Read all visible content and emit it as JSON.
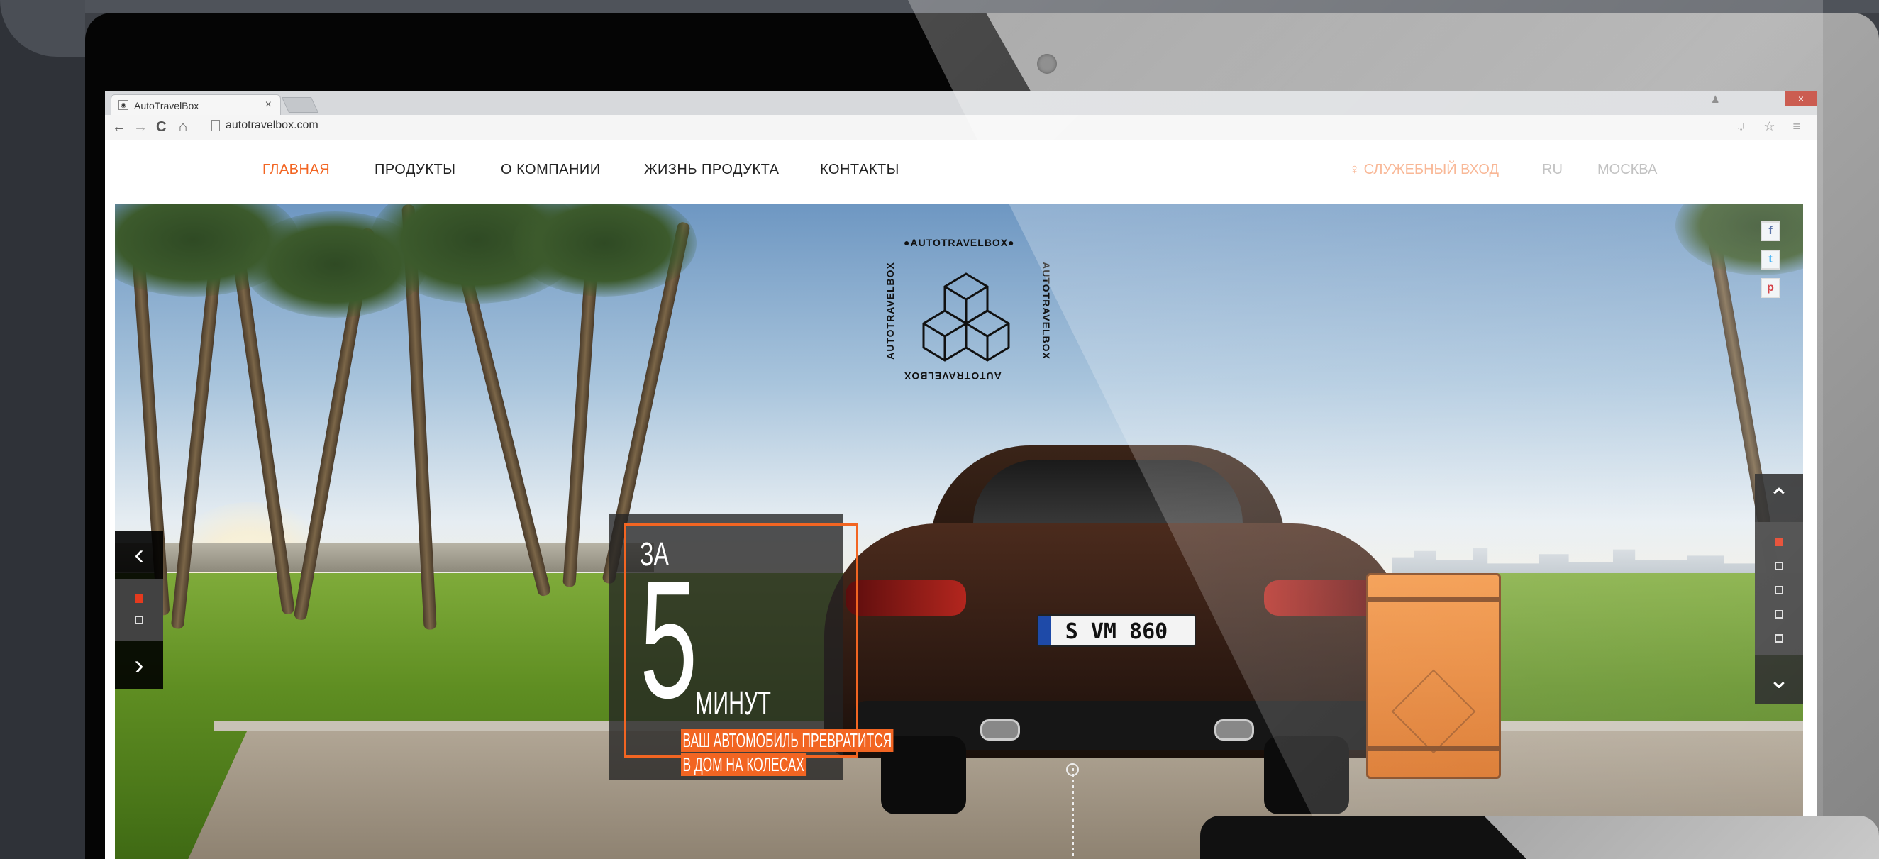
{
  "browser": {
    "tab_title": "AutoTravelBox",
    "tab_close": "×",
    "url": "autotravelbox.com",
    "back": "←",
    "forward": "→",
    "reload": "C",
    "home": "⌂",
    "addr_icons": "♅ ☆ ≡",
    "window_close": "×",
    "window_user": "♟"
  },
  "nav": {
    "items": [
      "ГЛАВНАЯ",
      "ПРОДУКТЫ",
      "О КОМПАНИИ",
      "ЖИЗНЬ ПРОДУКТА",
      "КОНТАКТЫ"
    ],
    "active_index": 0,
    "login": "СЛУЖЕБНЫЙ ВХОД",
    "lang": "RU",
    "city": "МОСКВА"
  },
  "hero": {
    "logo_text_top": "●AUTOTRAVELBOX●",
    "logo_text_side": "AUTOTRAVELBOX",
    "promo_za": "ЗА",
    "promo_number": "5",
    "promo_minutes": "МИНУТ",
    "promo_line1": "ВАШ АВТОМОБИЛЬ ПРЕВРАТИТСЯ",
    "promo_line2": "В ДОМ НА КОЛЕСАХ",
    "plate": "S VM 860",
    "prev_arrow": "‹",
    "next_arrow": "›",
    "up_arrow": "⌃",
    "down_arrow": "⌄",
    "left_dots": [
      true,
      false
    ],
    "right_dots": [
      true,
      false,
      false,
      false,
      false
    ]
  },
  "social": {
    "facebook": "f",
    "twitter": "t",
    "pinterest": "p"
  },
  "colors": {
    "accent": "#f26522",
    "active_dot": "#e53a1e",
    "login": "#f7a57b"
  }
}
